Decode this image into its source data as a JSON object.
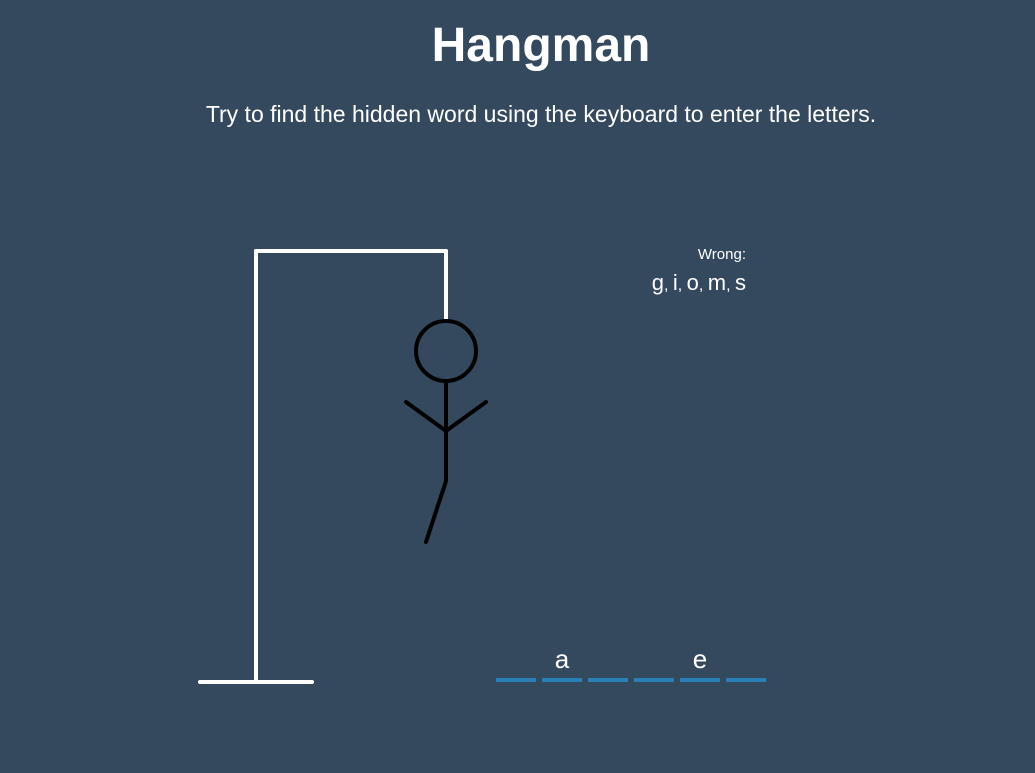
{
  "header": {
    "title": "Hangman",
    "instructions": "Try to find the hidden word using the keyboard to enter the letters."
  },
  "wrong": {
    "label": "Wrong:",
    "letters": [
      "g",
      "i",
      "o",
      "m",
      "s"
    ]
  },
  "word": {
    "slots": [
      "",
      "a",
      "",
      "",
      "e",
      ""
    ]
  },
  "figure": {
    "parts_shown": [
      "head",
      "body",
      "left-arm",
      "right-arm",
      "left-leg"
    ]
  },
  "colors": {
    "background": "#34495e",
    "text": "#ffffff",
    "gallows": "#ffffff",
    "figure": "#000000",
    "underline": "#2980b9"
  }
}
